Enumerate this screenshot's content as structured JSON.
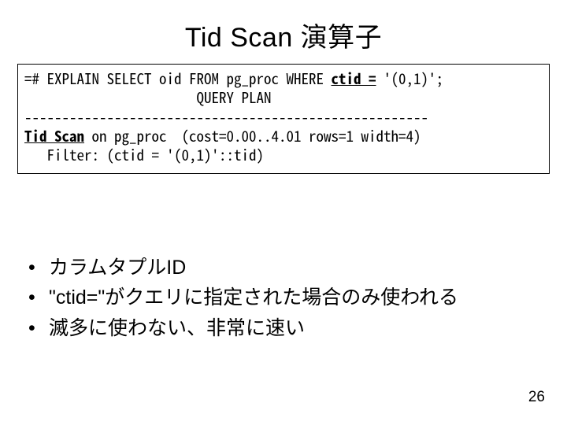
{
  "title": "Tid Scan 演算子",
  "code": {
    "l1a": "=# EXPLAIN SELECT oid FROM pg_proc WHERE ",
    "l1b": "ctid =",
    "l1c": " '(0,1)';",
    "l2": "                       QUERY PLAN",
    "l3": "------------------------------------------------------",
    "l4a": "Tid Scan",
    "l4b": " on pg_proc  (cost=0.00..4.01 rows=1 width=4)",
    "l5": "   Filter: (ctid = '(0,1)'::tid)"
  },
  "bullets": [
    "カラムタプルID",
    "\"ctid=\"がクエリに指定された場合のみ使われる",
    "滅多に使わない、非常に速い"
  ],
  "bullet_marker": "•",
  "page_number": "26"
}
